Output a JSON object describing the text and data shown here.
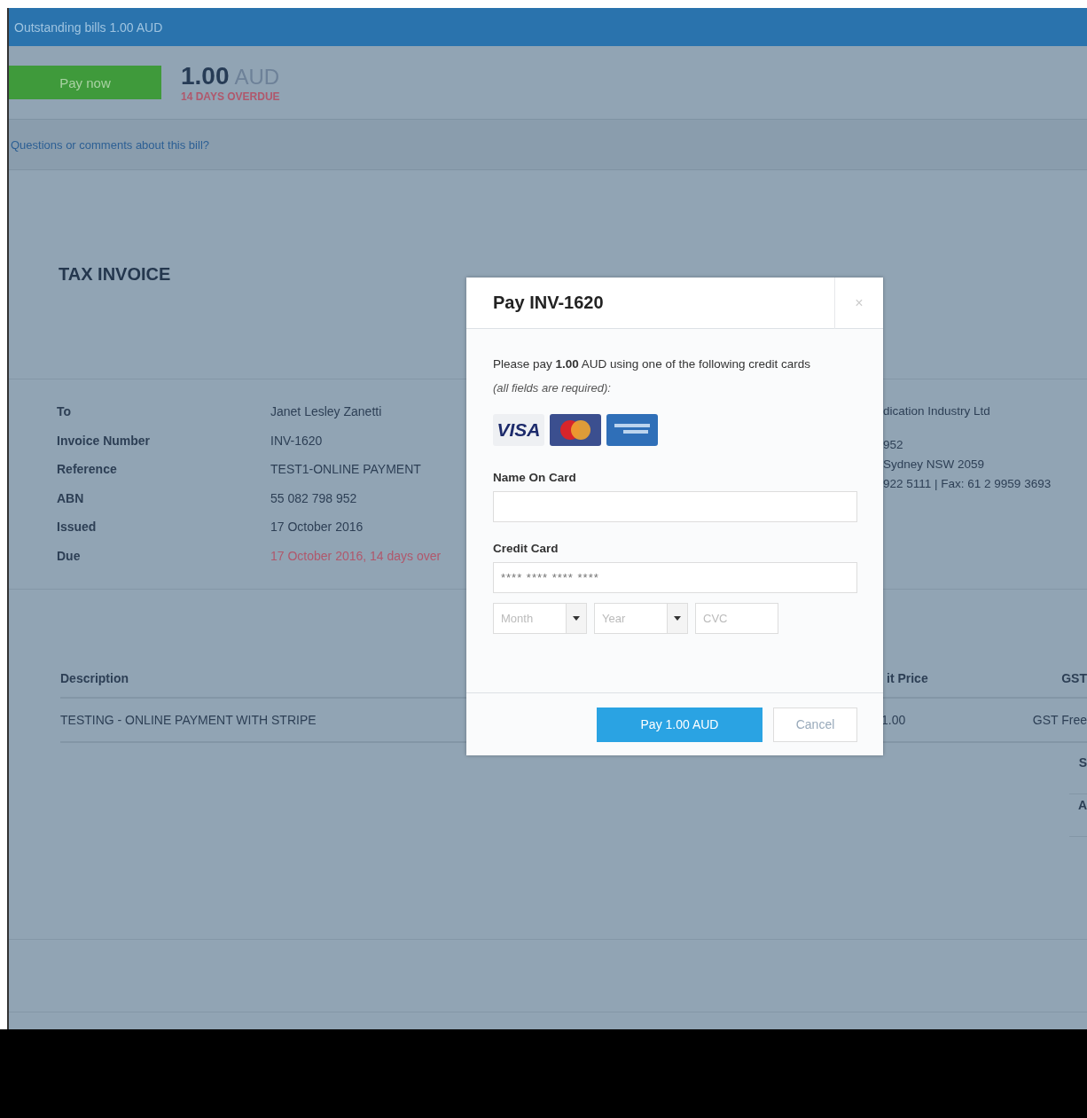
{
  "top_bar": {
    "title": "Outstanding bills 1.00 AUD"
  },
  "summary": {
    "pay_button": "Pay now",
    "amount": "1.00",
    "currency": "AUD",
    "overdue": "14 DAYS OVERDUE"
  },
  "questions_link": "Questions or comments about this bill?",
  "invoice": {
    "title": "TAX INVOICE",
    "details": [
      {
        "label": "To",
        "value": "Janet Lesley Zanetti",
        "overdue": false
      },
      {
        "label": "Invoice Number",
        "value": "INV-1620",
        "overdue": false
      },
      {
        "label": "Reference",
        "value": "TEST1-ONLINE PAYMENT",
        "overdue": false
      },
      {
        "label": "ABN",
        "value": "55 082 798 952",
        "overdue": false
      },
      {
        "label": "Issued",
        "value": "17 October 2016",
        "overdue": false
      },
      {
        "label": "Due",
        "value": "17 October 2016, 14 days over",
        "overdue": true
      }
    ],
    "from_lines": [
      "dication Industry Ltd",
      "952",
      "Sydney NSW 2059",
      "922 5111 | Fax: 61 2 9959 3693"
    ],
    "table": {
      "columns": [
        "Description",
        "it Price",
        "GST"
      ],
      "rows": [
        [
          "TESTING - ONLINE PAYMENT WITH STRIPE",
          "1.00",
          "GST Free"
        ]
      ]
    },
    "totals": [
      "S",
      "A"
    ]
  },
  "modal": {
    "title": "Pay INV-1620",
    "close": "×",
    "intro": "Please pay **1.00** AUD using one of the following credit cards",
    "note": "(all fields are required):",
    "cards": [
      {
        "kind": "visa",
        "label": "VISA"
      },
      {
        "kind": "mastercard"
      },
      {
        "kind": "amex"
      }
    ],
    "name_label": "Name On Card",
    "card_label": "Credit Card",
    "card_placeholder": "**** **** **** ****",
    "month_placeholder": "Month",
    "year_placeholder": "Year",
    "cvc_placeholder": "CVC",
    "pay_button": "Pay 1.00 AUD",
    "cancel_button": "Cancel"
  }
}
